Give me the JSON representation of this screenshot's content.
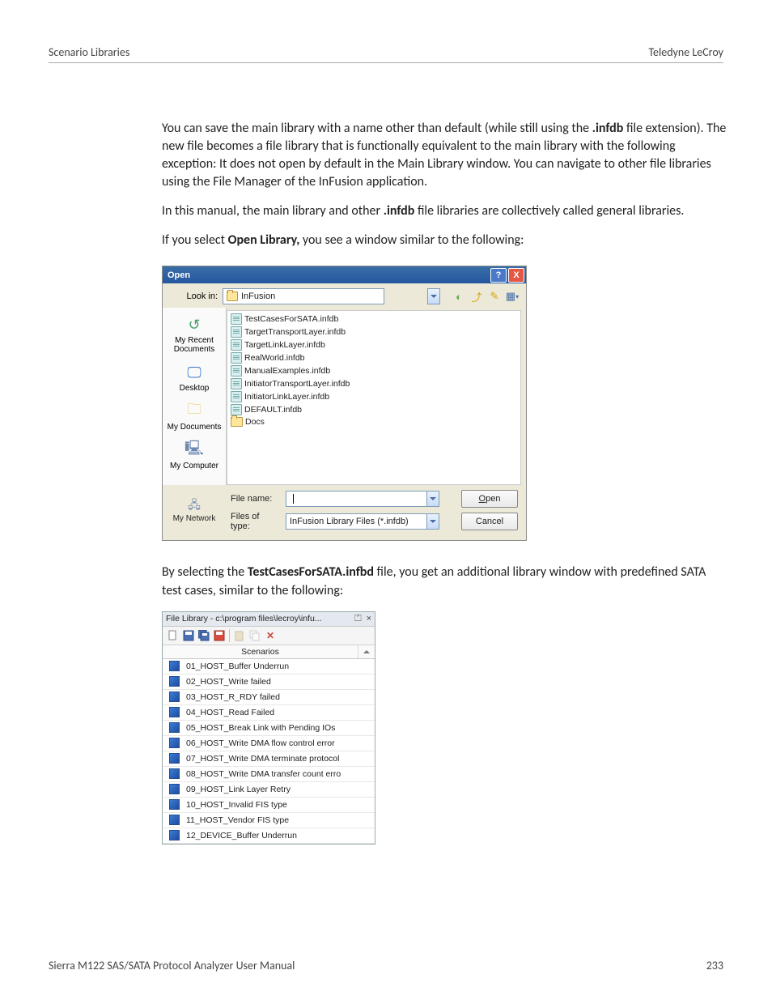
{
  "header": {
    "left": "Scenario Libraries",
    "right": "Teledyne LeCroy"
  },
  "paragraphs": {
    "p1_a": "You can save the main library with a name other than default (while still using the ",
    "p1_ext": ".infdb",
    "p1_b": " file extension). The new file becomes a file library that is functionally equivalent to the main library with the following exception: It does not open by default in the Main Library window. You can navigate to other file libraries using the File Manager of the InFusion application.",
    "p2_a": "In this manual, the main library and other ",
    "p2_ext": ".infdb",
    "p2_b": " file libraries are collectively called general libraries.",
    "p3_a": "If you select ",
    "p3_cmd": "Open Library,",
    "p3_b": " you see a window similar to the following:",
    "p4_a": "By selecting the ",
    "p4_file": "TestCasesForSATA.infbd",
    "p4_b": " file, you get an additional library window with predefined SATA test cases, similar to the following:"
  },
  "dialog": {
    "title": "Open",
    "lookin_label": "Look in:",
    "lookin_value": "InFusion",
    "places": {
      "recent": "My Recent Documents",
      "desktop": "Desktop",
      "mydocs": "My Documents",
      "mycomp": "My Computer",
      "mynet": "My Network"
    },
    "files": [
      "TestCasesForSATA.infdb",
      "TargetTransportLayer.infdb",
      "TargetLinkLayer.infdb",
      "RealWorld.infdb",
      "ManualExamples.infdb",
      "InitiatorTransportLayer.infdb",
      "InitiatorLinkLayer.infdb",
      "DEFAULT.infdb"
    ],
    "folder": "Docs",
    "filename_label": "File name:",
    "filename_value": "",
    "filetype_label": "Files of type:",
    "filetype_value": "InFusion Library Files (*.infdb)",
    "open_btn": "Open",
    "cancel_btn": "Cancel",
    "help_char": "?",
    "close_char": "X"
  },
  "filelib": {
    "title": "File Library - c:\\program files\\lecroy\\infu...",
    "pin_char": "⏍",
    "close_char": "×",
    "column": "Scenarios",
    "items": [
      "01_HOST_Buffer Underrun",
      "02_HOST_Write failed",
      "03_HOST_R_RDY failed",
      "04_HOST_Read Failed",
      "05_HOST_Break Link with Pending IOs",
      "06_HOST_Write DMA flow control error",
      "07_HOST_Write DMA terminate protocol",
      "08_HOST_Write DMA transfer count erro",
      "09_HOST_Link Layer Retry",
      "10_HOST_Invalid FIS type",
      "11_HOST_Vendor FIS type",
      "12_DEVICE_Buffer Underrun"
    ]
  },
  "footer": {
    "left": "Sierra M122 SAS/SATA Protocol Analyzer User Manual",
    "right": "233"
  }
}
